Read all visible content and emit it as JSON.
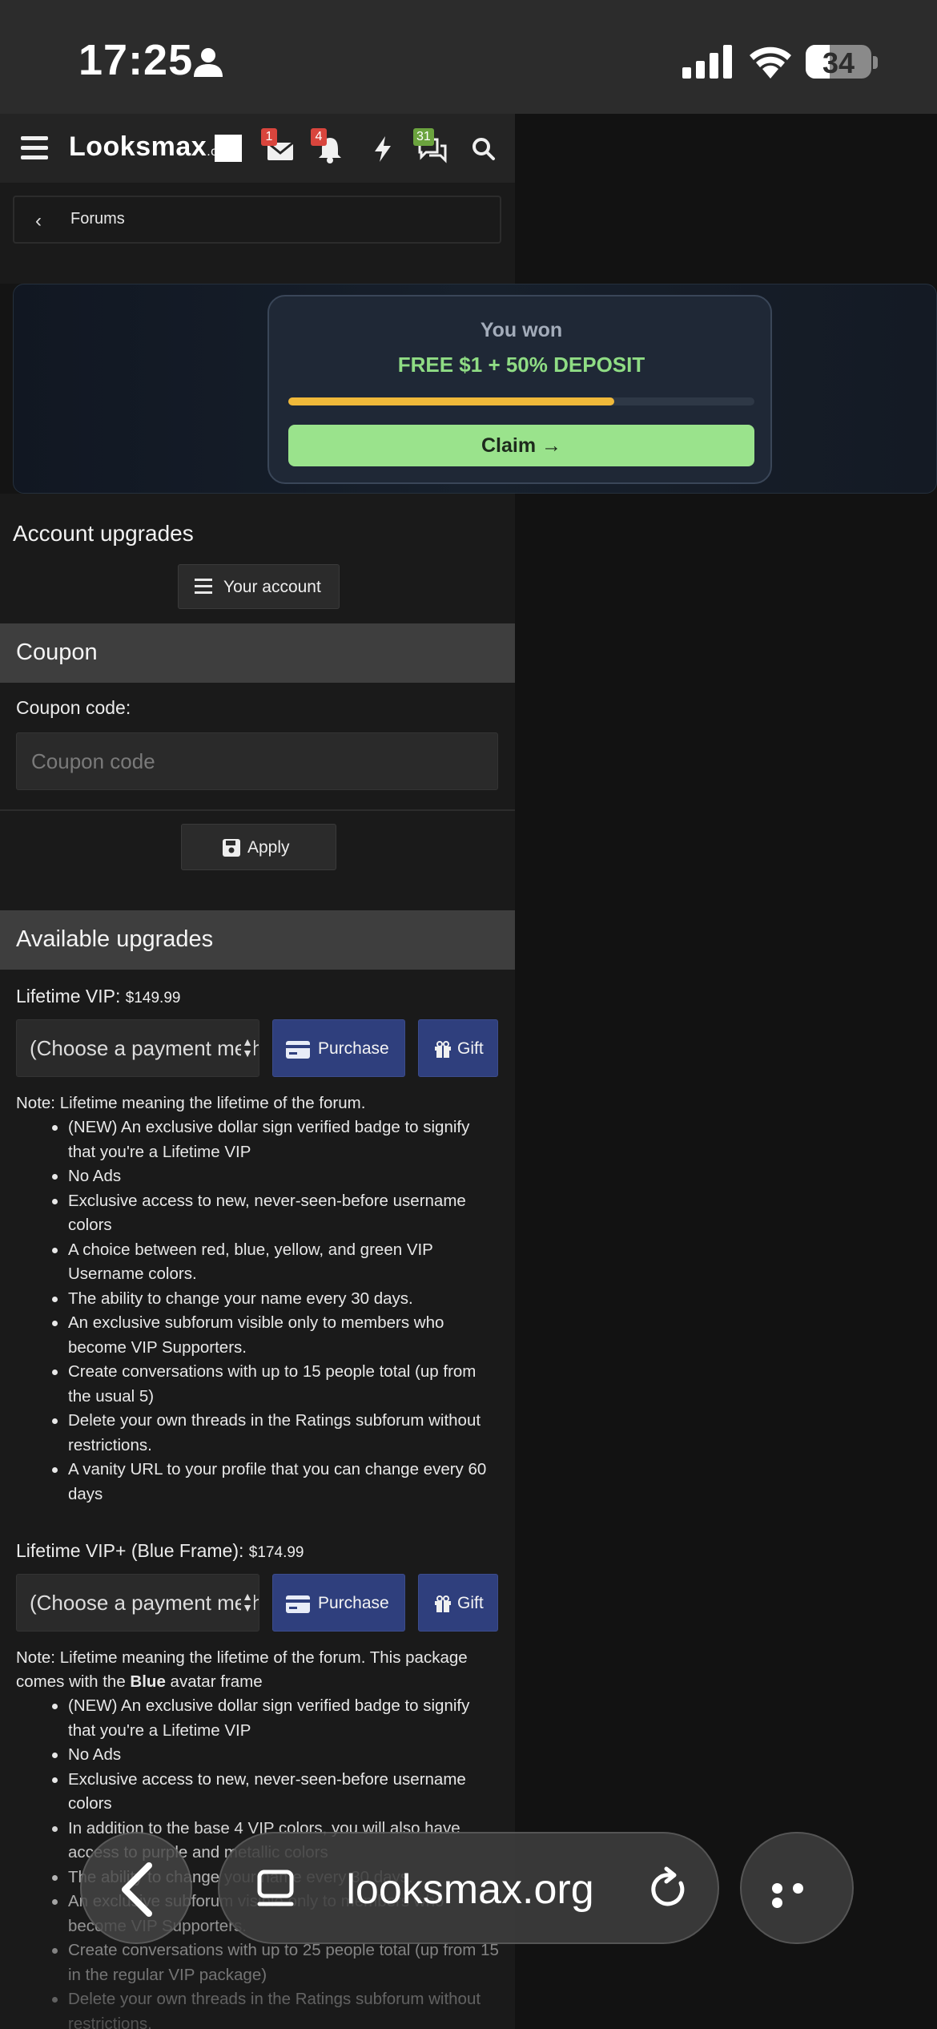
{
  "status_bar": {
    "time": "17:25",
    "battery": "34"
  },
  "header": {
    "logo_main": "Looksmax",
    "logo_suffix": ".org",
    "inbox_badge": "1",
    "alerts_badge": "4",
    "chat_badge": "31"
  },
  "breadcrumb": {
    "label": "Forums"
  },
  "ad": {
    "title": "You won",
    "subtitle": "FREE $1 + 50% DEPOSIT",
    "progress": 0.7,
    "claim_label": "Claim →"
  },
  "page": {
    "title": "Account upgrades",
    "your_account_label": "Your account"
  },
  "coupon": {
    "section_title": "Coupon",
    "label": "Coupon code:",
    "placeholder": "Coupon code",
    "apply_label": "Apply"
  },
  "upgrades": {
    "section_title": "Available upgrades",
    "select_label": "(Choose a payment method)",
    "purchase_label": "Purchase",
    "gift_label": "Gift",
    "items": [
      {
        "title": "Lifetime VIP:",
        "price": "$149.99",
        "note": "Note: Lifetime meaning the lifetime of the forum.",
        "benefits": [
          "(NEW) An exclusive dollar sign verified badge to signify that you're a Lifetime VIP",
          "No Ads",
          "Exclusive access to new, never-seen-before username colors",
          "A choice between red, blue, yellow, and green VIP Username colors.",
          "The ability to change your name every 30 days.",
          "An exclusive subforum visible only to members who become VIP Supporters.",
          "Create conversations with up to 15 people total (up from the usual 5)",
          "Delete your own threads in the Ratings subforum without restrictions.",
          "A vanity URL to your profile that you can change every 60 days"
        ]
      },
      {
        "title": "Lifetime VIP+ (Blue Frame):",
        "price": "$174.99",
        "note_prefix": "Note: Lifetime meaning the lifetime of the forum. This package comes with the ",
        "note_bold": "Blue",
        "note_suffix": " avatar frame",
        "benefits": [
          "(NEW) An exclusive dollar sign verified badge to signify that you're a Lifetime VIP",
          "No Ads",
          "Exclusive access to new, never-seen-before username colors",
          "In addition to the base 4 VIP colors, you will also have access to purple and metallic colors",
          "The ability to change your name every 30 days.",
          "An exclusive subforum visible only to members who become VIP Supporters.",
          "Create conversations with up to 25 people total (up from 15 in the regular VIP package)",
          "Delete your own threads in the Ratings subforum without restrictions."
        ]
      }
    ]
  },
  "browser": {
    "url": "looksmax.org"
  }
}
